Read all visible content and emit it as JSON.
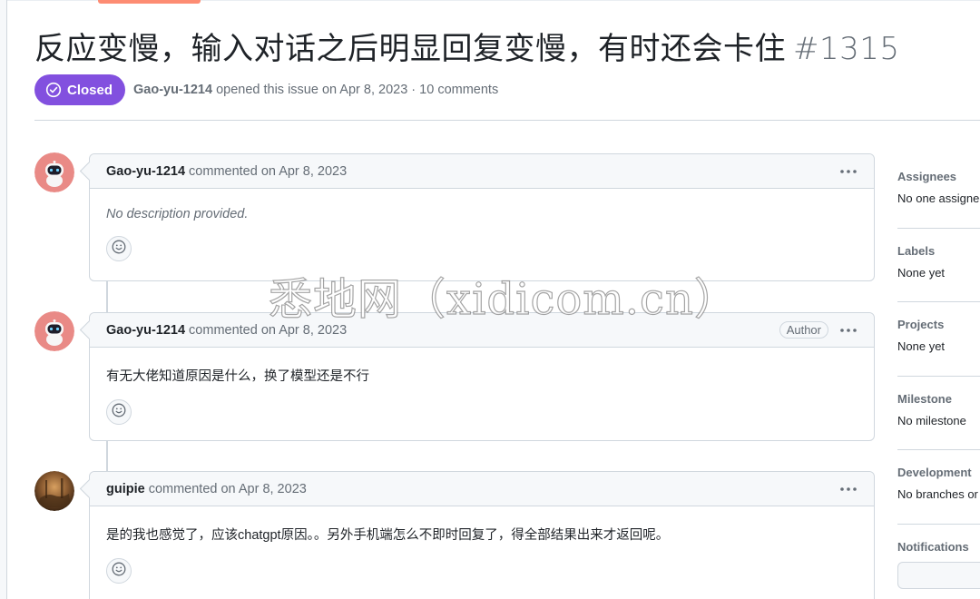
{
  "issue": {
    "title": "反应变慢，输入对话之后明显回复变慢，有时还会卡住",
    "number": "#1315",
    "state": "Closed",
    "state_color": "#8250df",
    "author": "Gao-yu-1214",
    "meta_text": "opened this issue on Apr 8, 2023 · 10 comments"
  },
  "comments": [
    {
      "author": "Gao-yu-1214",
      "timestamp": "commented on Apr 8, 2023",
      "badge": "",
      "body": "No description provided.",
      "avatar_icon": "robot-avatar-icon"
    },
    {
      "author": "Gao-yu-1214",
      "timestamp": "commented on Apr 8, 2023",
      "badge": "Author",
      "body": "有无大佬知道原因是什么，换了模型还是不行",
      "avatar_icon": "robot-avatar-icon"
    },
    {
      "author": "guipie",
      "timestamp": "commented on Apr 8, 2023",
      "badge": "",
      "body": "是的我也感觉了，应该chatgpt原因。。另外手机端怎么不即时回复了，得全部结果出来才返回呢。",
      "avatar_icon": "photo-avatar-icon"
    }
  ],
  "sidebar": {
    "sections": [
      {
        "heading": "Assignees",
        "value": "No one assigned"
      },
      {
        "heading": "Labels",
        "value": "None yet"
      },
      {
        "heading": "Projects",
        "value": "None yet"
      },
      {
        "heading": "Milestone",
        "value": "No milestone"
      },
      {
        "heading": "Development",
        "value": "No branches or pull requests"
      },
      {
        "heading": "Notifications",
        "value": ""
      }
    ]
  },
  "watermark": "悉地网（xidicom.cn）",
  "colors": {
    "accent": "#8250df",
    "tab_underline": "#fd8c73",
    "border": "#d0d7de",
    "muted_text": "#656d76"
  }
}
